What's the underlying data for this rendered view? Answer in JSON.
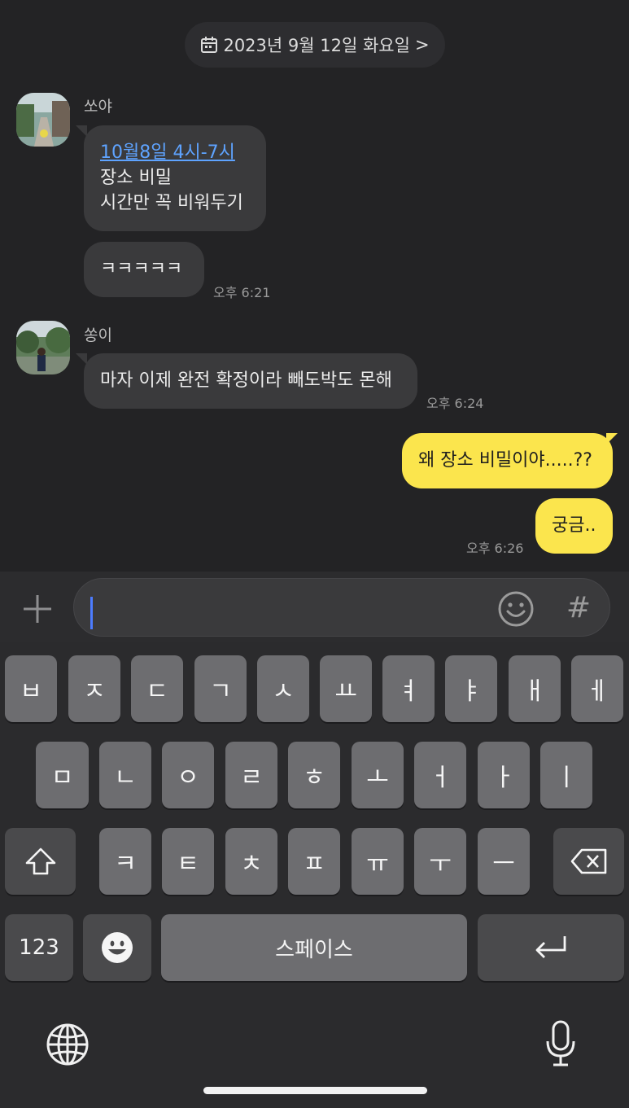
{
  "date_header": {
    "text": "2023년 9월 12일 화요일",
    "icon": "calendar-icon",
    "chevron": ">"
  },
  "messages": {
    "m1": {
      "sender": "쏘야",
      "link": "10월8일 4시-7시",
      "line2": "장소 비밀",
      "line3": "시간만 꼭 비워두기"
    },
    "m2": {
      "text": "ㅋㅋㅋㅋㅋ",
      "time": "오후 6:21"
    },
    "m3": {
      "sender": "쏭이",
      "text": "마자 이제 완전 확정이라 빼도박도 몬해",
      "time": "오후 6:24"
    },
    "m4": {
      "text": "왜 장소 비밀이야.....??"
    },
    "m5": {
      "text": "궁금..",
      "time": "오후 6:26"
    }
  },
  "input": {
    "placeholder": "",
    "hash_label": "#",
    "plus_icon": "plus-icon",
    "emoji_icon": "emoji-icon"
  },
  "keyboard": {
    "row1": [
      "ㅂ",
      "ㅈ",
      "ㄷ",
      "ㄱ",
      "ㅅ",
      "ㅛ",
      "ㅕ",
      "ㅑ",
      "ㅐ",
      "ㅔ"
    ],
    "row2": [
      "ㅁ",
      "ㄴ",
      "ㅇ",
      "ㄹ",
      "ㅎ",
      "ㅗ",
      "ㅓ",
      "ㅏ",
      "ㅣ"
    ],
    "row3": [
      "ㅋ",
      "ㅌ",
      "ㅊ",
      "ㅍ",
      "ㅠ",
      "ㅜ",
      "ㅡ"
    ],
    "numbers_label": "123",
    "space_label": "스페이스"
  },
  "colors": {
    "my_bubble": "#fbe54d",
    "their_bubble": "#3a3a3c",
    "background": "#232325",
    "link": "#5ea3ff",
    "caret": "#4c7cff"
  }
}
